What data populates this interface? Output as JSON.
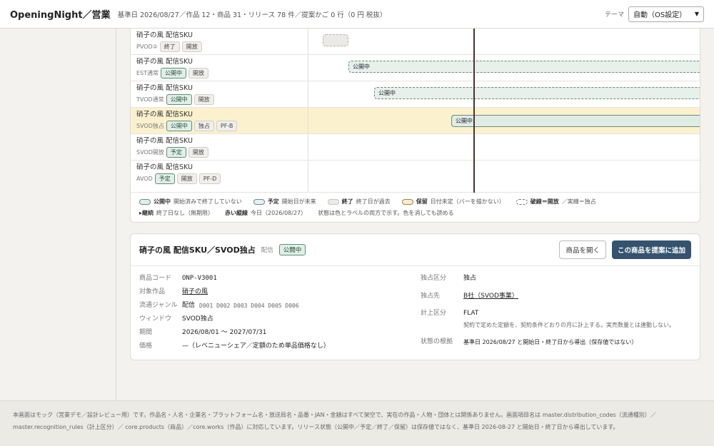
{
  "header": {
    "brand": "OpeningNight／営業",
    "meta": "基準日 2026/08/27／作品 12・商品 31・リリース 78 件／提案かご 0 行（0 円 税抜）",
    "theme_label": "テーマ",
    "theme_value": "自動（OS設定）"
  },
  "timeline": {
    "rows": [
      {
        "title": "硝子の風 配信SKU",
        "window": "PVOD②",
        "chips": [
          "終了",
          "開放"
        ],
        "bar": "",
        "bar_kind": "ended"
      },
      {
        "title": "硝子の風 配信SKU",
        "window": "EST通常",
        "chips": [
          "公開中",
          "開放"
        ],
        "bar": "公開中",
        "bar_kind": "dashed"
      },
      {
        "title": "硝子の風 配信SKU",
        "window": "TVOD通常",
        "chips": [
          "公開中",
          "開放"
        ],
        "bar": "公開中",
        "bar_kind": "dashed"
      },
      {
        "title": "硝子の風 配信SKU",
        "window": "SVOD独占",
        "chips": [
          "公開中",
          "独占",
          "PF-B"
        ],
        "bar": "公開中",
        "bar_kind": "solid"
      },
      {
        "title": "硝子の風 配信SKU",
        "window": "SVOD開放",
        "chips": [
          "予定",
          "開放"
        ],
        "bar": "",
        "bar_kind": "none"
      },
      {
        "title": "硝子の風 配信SKU",
        "window": "AVOD",
        "chips": [
          "予定",
          "開放",
          "PF-D"
        ],
        "bar": "",
        "bar_kind": "none"
      }
    ],
    "legend": {
      "live_name": "公開中",
      "live_desc": "開始済みで終了していない",
      "plan_name": "予定",
      "plan_desc": "開始日が未来",
      "ended_name": "終了",
      "ended_desc": "終了日が過去",
      "hold_name": "保留",
      "hold_desc": "日付未定（バーを描かない）",
      "dash_name": "破線＝開放",
      "dash_desc": "／実線＝独占",
      "cont_name": "▸継続",
      "cont_desc": "終了日なし（無期限）",
      "today_name": "赤い縦線",
      "today_desc": "今日（2026/08/27）",
      "note": "状態は色とラベルの両方で示す。色を消しても読める"
    }
  },
  "detail": {
    "title": "硝子の風 配信SKU／SVOD独占",
    "kind": "配信",
    "status": "公開中",
    "open_button": "商品を開く",
    "add_button": "この商品を提案に追加",
    "left": {
      "code_k": "商品コード",
      "code_v": "ONP-V3001",
      "work_k": "対象作品",
      "work_v": "硝子の風",
      "genre_k": "流通ジャンル",
      "genre_v": "配信",
      "genre_codes": "D001 D002 D003 D004 D005 D006",
      "window_k": "ウィンドウ",
      "window_v": "SVOD独占",
      "period_k": "期間",
      "period_v": "2026/08/01 ～ 2027/07/31",
      "price_k": "価格",
      "price_v": "—（レベニューシェア／定額のため単品価格なし）"
    },
    "right": {
      "excl_k": "独占区分",
      "excl_v": "独占",
      "excl_to_k": "独占先",
      "excl_to_v": "B社（SVOD事業）",
      "recog_k": "計上区分",
      "recog_v": "FLAT",
      "recog_note": "契約で定めた定額を、契約条件どおりの月に計上する。実売数量とは連動しない。",
      "basis_k": "状態の根拠",
      "basis_v": "基準日 2026/08/27 と開始日・終了日から導出（保存値ではない）"
    }
  },
  "footer": {
    "line1": "本画面はモック（営業デモ／設計レビュー用）です。作品名・人名・企業名・プラットフォーム名・放送局名・品番・JAN・金額はすべて架空で、実在の作品・人物・団体とは関係ありません。画面項目名は master.distribution_codes（流通種別）／",
    "line2": "master.recognition_rules（計上区分）／ core.products（商品）／core.works（作品）に対応しています。リリース状態（公開中／予定／終了／保留）は保存値ではなく、基準日 2026-08-27 と開始日・終了日から導出しています。"
  },
  "colors": {
    "accent": "#35536e",
    "live": "#e2eee7",
    "highlight": "#fcf1cf",
    "today_line": "#4a3333"
  }
}
